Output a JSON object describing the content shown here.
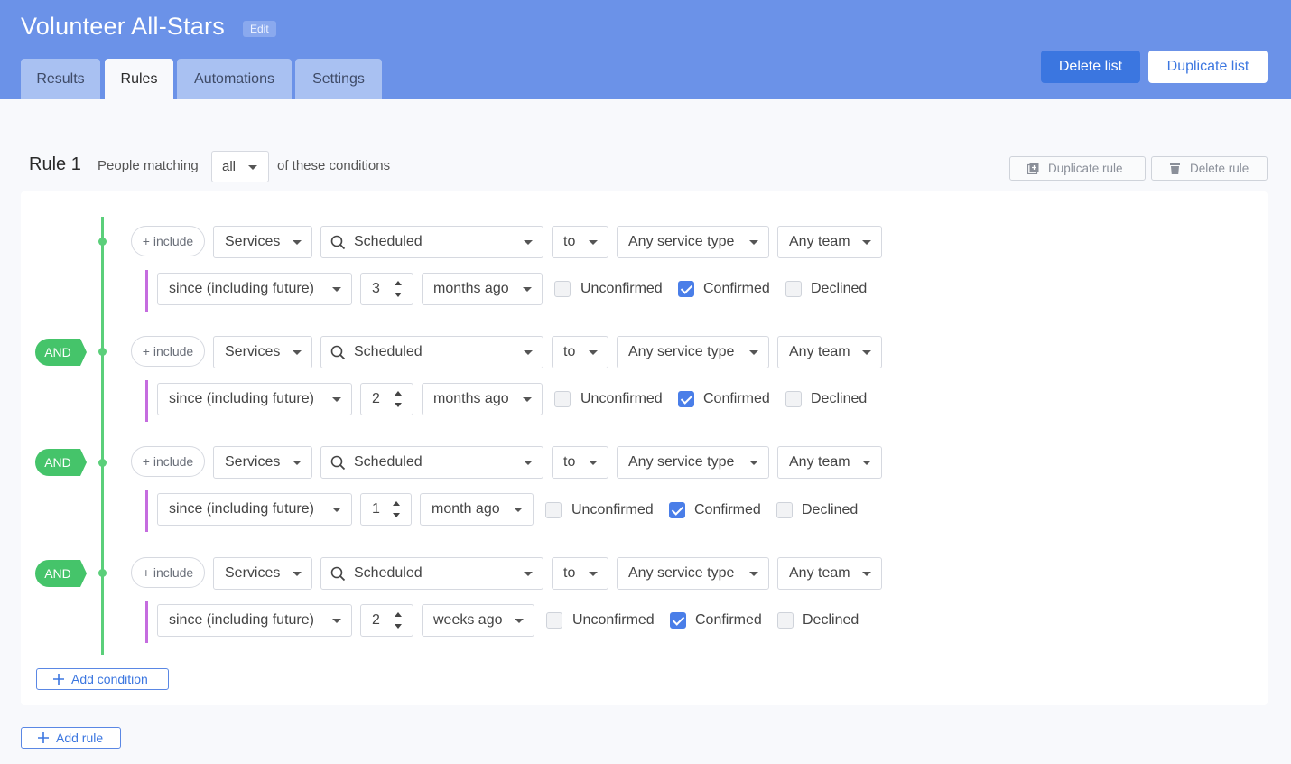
{
  "header": {
    "title": "Volunteer All-Stars",
    "edit_label": "Edit",
    "tabs": [
      {
        "label": "Results",
        "active": false
      },
      {
        "label": "Rules",
        "active": true
      },
      {
        "label": "Automations",
        "active": false
      },
      {
        "label": "Settings",
        "active": false
      }
    ],
    "delete_list_label": "Delete list",
    "duplicate_list_label": "Duplicate list",
    "accent_color": "#6b92e8"
  },
  "rule": {
    "label": "Rule 1",
    "matching_prefix": "People matching",
    "matching_value": "all",
    "matching_suffix": "of these conditions",
    "duplicate_rule_label": "Duplicate rule",
    "delete_rule_label": "Delete rule",
    "and_label": "AND",
    "conditions": [
      {
        "include_label": "+ include",
        "category": "Services",
        "search_value": "Scheduled",
        "to_label": "to",
        "service_type": "Any service type",
        "team": "Any team",
        "since_label": "since (including future)",
        "number": "3",
        "unit": "months ago",
        "statuses": [
          {
            "label": "Unconfirmed",
            "checked": false
          },
          {
            "label": "Confirmed",
            "checked": true
          },
          {
            "label": "Declined",
            "checked": false
          }
        ]
      },
      {
        "include_label": "+ include",
        "category": "Services",
        "search_value": "Scheduled",
        "to_label": "to",
        "service_type": "Any service type",
        "team": "Any team",
        "since_label": "since (including future)",
        "number": "2",
        "unit": "months ago",
        "statuses": [
          {
            "label": "Unconfirmed",
            "checked": false
          },
          {
            "label": "Confirmed",
            "checked": true
          },
          {
            "label": "Declined",
            "checked": false
          }
        ]
      },
      {
        "include_label": "+ include",
        "category": "Services",
        "search_value": "Scheduled",
        "to_label": "to",
        "service_type": "Any service type",
        "team": "Any team",
        "since_label": "since (including future)",
        "number": "1",
        "unit": "month ago",
        "statuses": [
          {
            "label": "Unconfirmed",
            "checked": false
          },
          {
            "label": "Confirmed",
            "checked": true
          },
          {
            "label": "Declined",
            "checked": false
          }
        ]
      },
      {
        "include_label": "+ include",
        "category": "Services",
        "search_value": "Scheduled",
        "to_label": "to",
        "service_type": "Any service type",
        "team": "Any team",
        "since_label": "since (including future)",
        "number": "2",
        "unit": "weeks ago",
        "statuses": [
          {
            "label": "Unconfirmed",
            "checked": false
          },
          {
            "label": "Confirmed",
            "checked": true
          },
          {
            "label": "Declined",
            "checked": false
          }
        ]
      }
    ],
    "add_condition_label": "Add condition",
    "timeline_color": "#5bcf7a"
  },
  "add_rule_label": "Add rule"
}
